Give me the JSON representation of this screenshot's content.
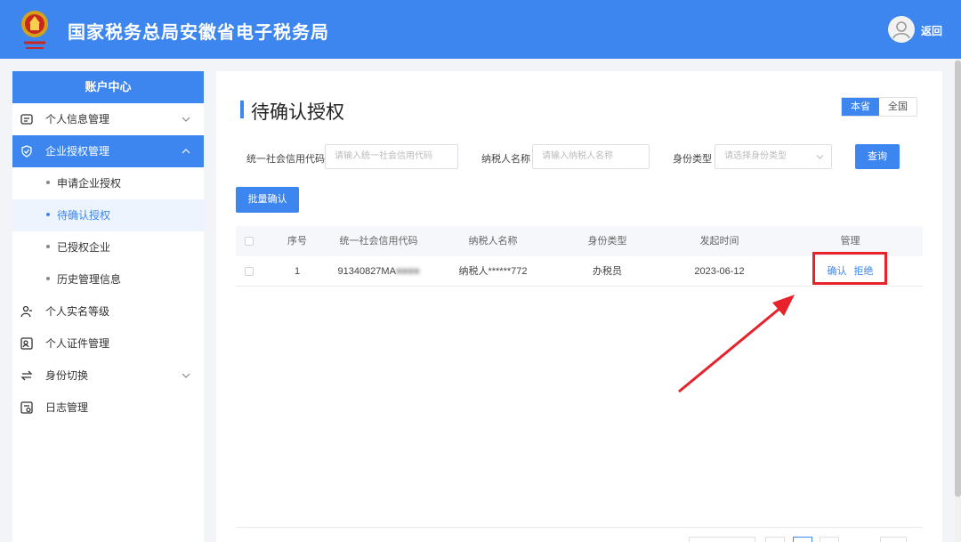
{
  "header": {
    "title": "国家税务总局安徽省电子税务局",
    "back_label": "返回"
  },
  "sidebar": {
    "title": "账户中心",
    "items": [
      {
        "label": "个人信息管理",
        "icon": "id-card-icon",
        "expandable": true
      },
      {
        "label": "企业授权管理",
        "icon": "shield-check-icon",
        "expandable": true,
        "active": true
      },
      {
        "label": "申请企业授权",
        "sub": true
      },
      {
        "label": "待确认授权",
        "sub": true,
        "current": true
      },
      {
        "label": "已授权企业",
        "sub": true
      },
      {
        "label": "历史管理信息",
        "sub": true
      },
      {
        "label": "个人实名等级",
        "icon": "user-level-icon"
      },
      {
        "label": "个人证件管理",
        "icon": "certificate-icon"
      },
      {
        "label": "身份切换",
        "icon": "switch-icon",
        "expandable": true
      },
      {
        "label": "日志管理",
        "icon": "log-icon"
      }
    ]
  },
  "main": {
    "title": "待确认授权",
    "scope": {
      "local": "本省",
      "national": "全国"
    },
    "filters": {
      "credit_code_label": "统一社会信用代码",
      "credit_code_placeholder": "请输入统一社会信用代码",
      "taxpayer_label": "纳税人名称",
      "taxpayer_placeholder": "请输入纳税人名称",
      "identity_label": "身份类型",
      "identity_placeholder": "请选择身份类型",
      "query_label": "查询"
    },
    "batch_confirm_label": "批量确认",
    "table": {
      "headers": [
        "序号",
        "统一社会信用代码",
        "纳税人名称",
        "身份类型",
        "发起时间",
        "管理"
      ],
      "rows": [
        {
          "index": "1",
          "credit_code_visible": "91340827MA",
          "credit_code_hidden": "■■■■",
          "taxpayer": "纳税人******772",
          "identity": "办税员",
          "date": "2023-06-12",
          "confirm": "确认",
          "reject": "拒绝"
        }
      ]
    }
  },
  "colors": {
    "primary": "#3d86f0",
    "annotation": "#e8222b"
  }
}
